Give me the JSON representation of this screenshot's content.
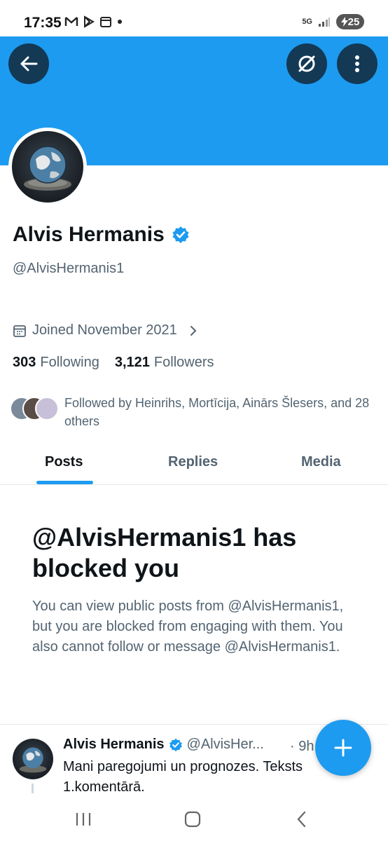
{
  "status_bar": {
    "time": "17:35",
    "network": "5G",
    "battery": "25"
  },
  "colors": {
    "accent": "#1d9bf0",
    "text_primary": "#0f1419",
    "text_secondary": "#536471"
  },
  "profile": {
    "name": "Alvis Hermanis",
    "handle": "@AlvisHermanis1",
    "verified": true,
    "joined": "Joined November 2021",
    "following_count": "303",
    "following_label": "Following",
    "followers_count": "3,121",
    "followers_label": "Followers",
    "followed_by": "Followed by Heinrihs, Mortīcija, Ainārs Šlesers, and 28 others"
  },
  "tabs": [
    {
      "label": "Posts",
      "active": true
    },
    {
      "label": "Replies",
      "active": false
    },
    {
      "label": "Media",
      "active": false
    }
  ],
  "blocked": {
    "title": "@AlvisHermanis1 has blocked you",
    "body": "You can view public posts from @AlvisHermanis1, but you are blocked from engaging with them. You also cannot follow or message @AlvisHermanis1."
  },
  "tweet": {
    "name": "Alvis Hermanis",
    "handle": "@AlvisHer...",
    "time": "· 9h",
    "text": "Mani paregojumi un prognozes. Teksts 1.komentārā."
  }
}
